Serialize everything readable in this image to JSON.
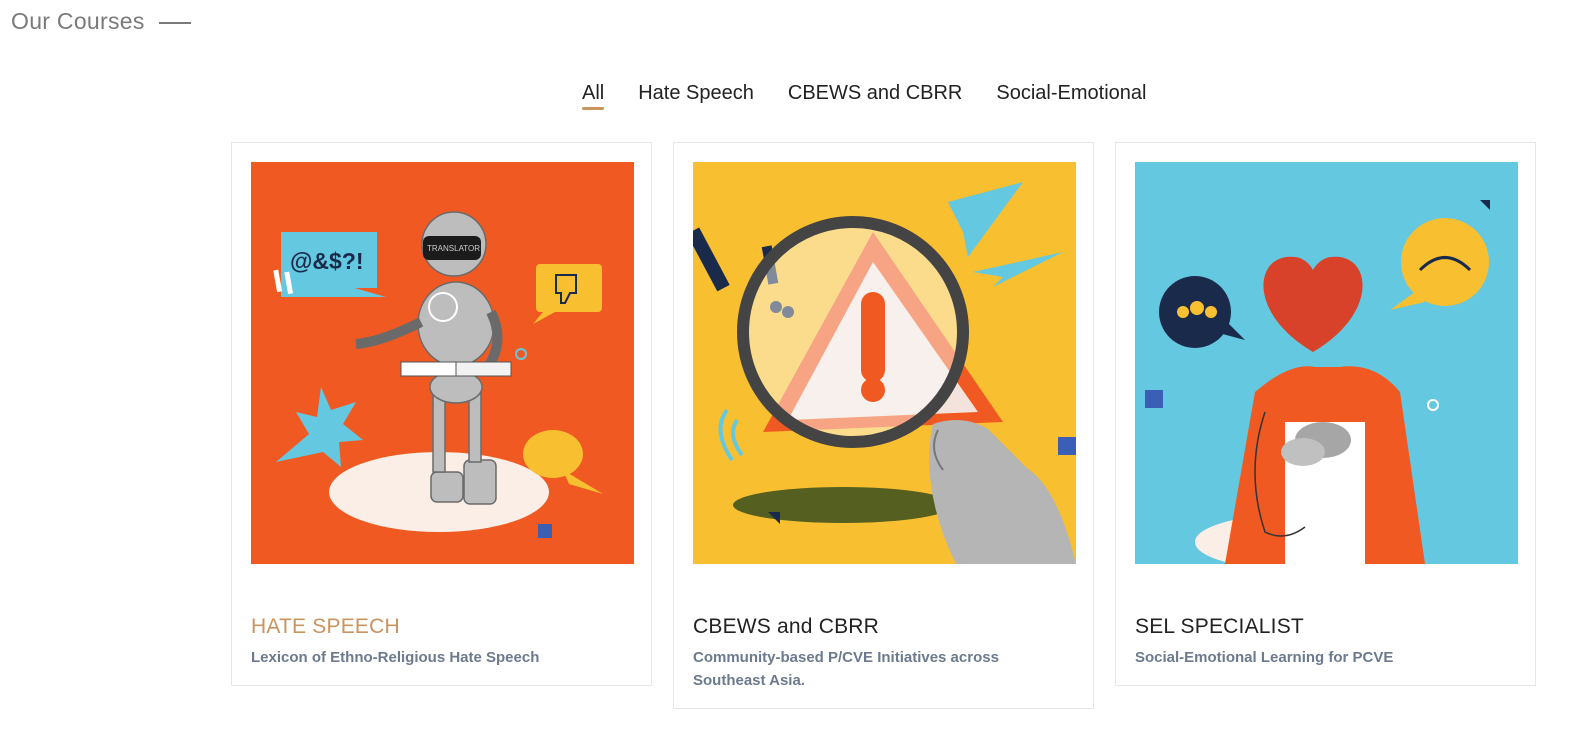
{
  "header": {
    "title": "Our Courses"
  },
  "tabs": [
    {
      "label": "All",
      "active": true
    },
    {
      "label": "Hate Speech",
      "active": false
    },
    {
      "label": "CBEWS and CBRR",
      "active": false
    },
    {
      "label": "Social-Emotional",
      "active": false
    }
  ],
  "courses": [
    {
      "title": "HATE SPEECH",
      "description": "Lexicon of Ethno-Religious Hate Speech",
      "image_icon": "robot-translator-illustration",
      "image_text": {
        "speech": "@&$?!",
        "visor": "TRANSLATOR"
      },
      "bg_color": "#f05a22"
    },
    {
      "title": "CBEWS and CBRR",
      "description": "Community-based P/CVE Initiatives across Southeast Asia.",
      "image_icon": "magnifying-glass-warning-illustration",
      "bg_color": "#f8bf30"
    },
    {
      "title": "SEL SPECIALIST",
      "description": "Social-Emotional Learning for PCVE",
      "image_icon": "heart-person-illustration",
      "bg_color": "#64c8e0"
    }
  ],
  "colors": {
    "accent": "#c9945f",
    "text": "#222222",
    "muted": "#6d7a8e"
  }
}
